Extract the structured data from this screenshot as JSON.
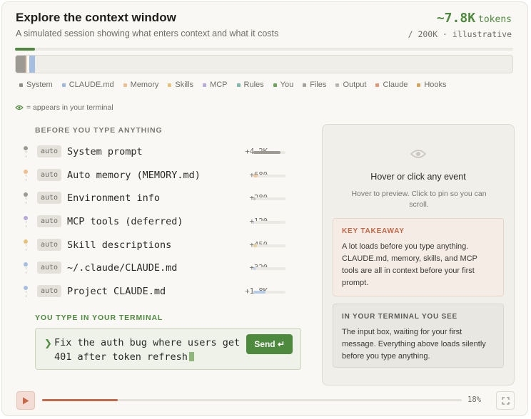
{
  "header": {
    "title": "Explore the context window",
    "subtitle": "A simulated session showing what enters context and what it costs",
    "tokens_value": "~7.8K",
    "tokens_unit": "tokens",
    "tokens_sub": "/ 200K · illustrative"
  },
  "timeline_progress": 0.04,
  "context_segments": [
    {
      "category": "System",
      "color": "#9c9a93",
      "fraction": 0.021
    },
    {
      "category": "Memory",
      "color": "#efbf8f",
      "fraction": 0.003
    },
    {
      "category": "Skills",
      "color": "#e6c27a",
      "fraction": 0.002
    },
    {
      "category": "MCP",
      "color": "#b7a9d8",
      "fraction": 0.001
    },
    {
      "category": "CLAUDE.md",
      "color": "#a6bfe0",
      "fraction": 0.011
    }
  ],
  "legend": [
    {
      "label": "System",
      "color": "#8f8d86"
    },
    {
      "label": "CLAUDE.md",
      "color": "#9cb7de"
    },
    {
      "label": "Memory",
      "color": "#efbf8f"
    },
    {
      "label": "Skills",
      "color": "#e6c27a"
    },
    {
      "label": "MCP",
      "color": "#b7a9d8"
    },
    {
      "label": "Rules",
      "color": "#7fb8a8"
    },
    {
      "label": "You",
      "color": "#6da35a"
    },
    {
      "label": "Files",
      "color": "#a3a19a"
    },
    {
      "label": "Output",
      "color": "#b9b7b0"
    },
    {
      "label": "Claude",
      "color": "#e0987a"
    },
    {
      "label": "Hooks",
      "color": "#d6a35b"
    }
  ],
  "eye_note": "= appears in your terminal",
  "before_label": "Before you type anything",
  "events": [
    {
      "badge": "auto",
      "name": "System prompt",
      "cost": "+4.2K",
      "dot": "#9c9a93",
      "fill": "#9c9a93",
      "share": 0.85
    },
    {
      "badge": "auto",
      "name": "Auto memory (MEMORY.md)",
      "cost": "+680",
      "dot": "#efbf8f",
      "fill": "#efc7a0",
      "share": 0.14
    },
    {
      "badge": "auto",
      "name": "Environment info",
      "cost": "+280",
      "dot": "#9c9a93",
      "fill": "#bdbbb4",
      "share": 0.06
    },
    {
      "badge": "auto",
      "name": "MCP tools (deferred)",
      "cost": "+120",
      "dot": "#b7a9d8",
      "fill": "#c9bfe3",
      "share": 0.03
    },
    {
      "badge": "auto",
      "name": "Skill descriptions",
      "cost": "+450",
      "dot": "#e6c27a",
      "fill": "#ecd09a",
      "share": 0.1
    },
    {
      "badge": "auto",
      "name": "~/.claude/CLAUDE.md",
      "cost": "+320",
      "dot": "#a6bfe0",
      "fill": "#b6cbe6",
      "share": 0.07
    },
    {
      "badge": "auto",
      "name": "Project CLAUDE.md",
      "cost": "+1.8K",
      "dot": "#a6bfe0",
      "fill": "#b6cbe6",
      "share": 0.37
    }
  ],
  "you_label": "You type in your terminal",
  "prompt": {
    "chevron": "❯",
    "text": "Fix the auth bug where users get 401 after token refresh",
    "send_label": "Send ↵"
  },
  "panel": {
    "hover_title": "Hover or click any event",
    "hover_sub": "Hover to preview. Click to pin so you can scroll.",
    "takeaway_heading": "Key takeaway",
    "takeaway_body": "A lot loads before you type anything. CLAUDE.md, memory, skills, and MCP tools are all in context before your first prompt.",
    "terminal_heading": "In your terminal you see",
    "terminal_body": "The input box, waiting for your first message. Everything above loads silently before you type anything."
  },
  "playback": {
    "progress": 0.18,
    "percent_label": "18%"
  }
}
